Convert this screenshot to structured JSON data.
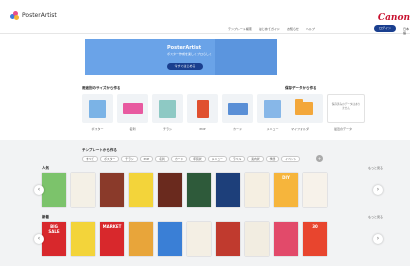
{
  "header": {
    "logo_text": "PosterArtist",
    "brand": "Canon",
    "nav": [
      "テンプレート検索",
      "はじめてガイド",
      "お知らせ",
      "ヘルプ"
    ],
    "login_label": "ログイン",
    "lang": "日本語"
  },
  "banner": {
    "title": "PosterArtist",
    "subtitle": "ポスター作成を楽しくプロらしく",
    "cta": "今すぐはじめる"
  },
  "size_section": {
    "title": "用途別のサイズから作る",
    "items": [
      "ポスター",
      "名刺",
      "チラシ",
      "POP",
      "カード",
      "メニュー"
    ],
    "colors": [
      "#7bb3e6",
      "#e85aa0",
      "#8ec9c4",
      "#e0502f",
      "#5a8fd6",
      "#87b7e8"
    ]
  },
  "saved_section": {
    "title": "保存データから作る",
    "folder_label": "マイフォルダ",
    "empty_text": "保存済みのデータはありません",
    "recent_label": "最近のデータ"
  },
  "template_section": {
    "title": "テンプレートから作る",
    "chips": [
      "すべて",
      "ポスター",
      "チラシ",
      "POP",
      "名刺",
      "カード",
      "年賀状",
      "メニュー",
      "ラベル",
      "案内状",
      "季節",
      "イベント",
      "セール"
    ],
    "more_label": "+"
  },
  "rows": [
    {
      "label": "人気",
      "more": "もっと見る",
      "thumbs": [
        {
          "bg": "#7cc36b",
          "text": ""
        },
        {
          "bg": "#f4f0e6",
          "text": ""
        },
        {
          "bg": "#8a3a2a",
          "text": ""
        },
        {
          "bg": "#f3d43a",
          "text": ""
        },
        {
          "bg": "#6a2a1e",
          "text": ""
        },
        {
          "bg": "#2e5a3a",
          "text": ""
        },
        {
          "bg": "#1d3f7a",
          "text": ""
        },
        {
          "bg": "#f5efe2",
          "text": ""
        },
        {
          "bg": "#f6b53c",
          "text": "DIY"
        },
        {
          "bg": "#f7f2ea",
          "text": ""
        }
      ]
    },
    {
      "label": "新着",
      "more": "もっと見る",
      "thumbs": [
        {
          "bg": "#d8282c",
          "text": "BIG SALE"
        },
        {
          "bg": "#f3d43a",
          "text": ""
        },
        {
          "bg": "#d8282c",
          "text": "MARKET"
        },
        {
          "bg": "#e8a53a",
          "text": ""
        },
        {
          "bg": "#3a7fd6",
          "text": ""
        },
        {
          "bg": "#f4efe4",
          "text": ""
        },
        {
          "bg": "#c03a2e",
          "text": ""
        },
        {
          "bg": "#f2ede1",
          "text": ""
        },
        {
          "bg": "#e24a6a",
          "text": ""
        },
        {
          "bg": "#e8452e",
          "text": "30"
        }
      ]
    }
  ],
  "arrows": {
    "prev": "‹",
    "next": "›"
  }
}
